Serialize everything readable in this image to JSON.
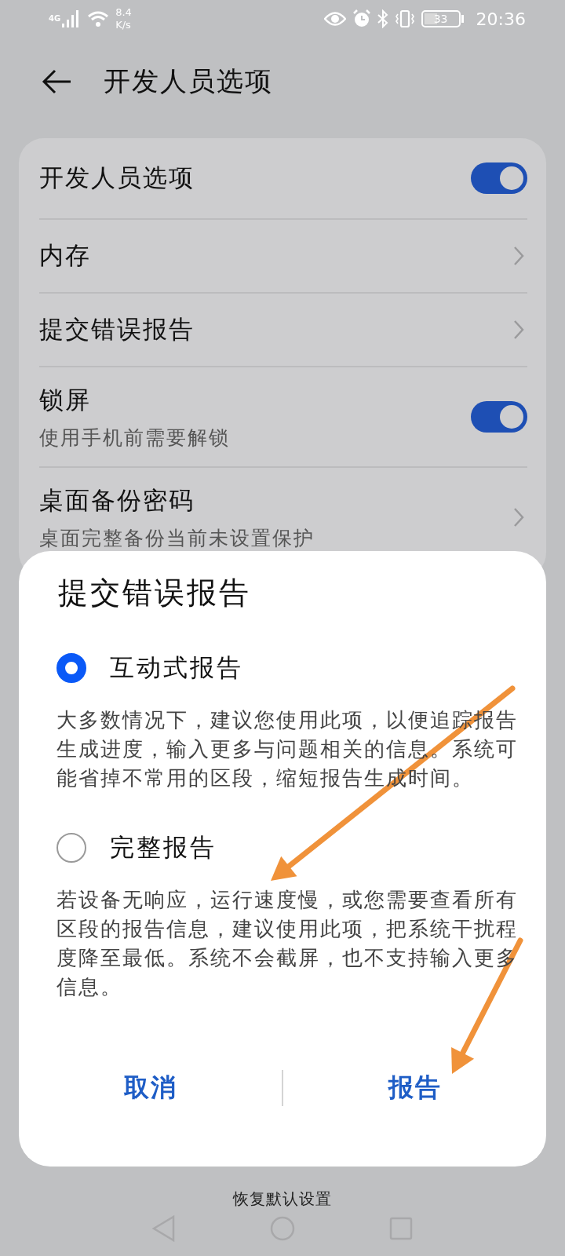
{
  "status_bar": {
    "network": "4G",
    "speed_value": "8.4",
    "speed_unit": "K/s",
    "battery": "33",
    "time": "20:36"
  },
  "header": {
    "title": "开发人员选项"
  },
  "settings": [
    {
      "kind": "toggle",
      "label": "开发人员选项",
      "on": true
    },
    {
      "kind": "link",
      "label": "内存"
    },
    {
      "kind": "link",
      "label": "提交错误报告"
    },
    {
      "kind": "toggle",
      "label": "锁屏",
      "subtitle": "使用手机前需要解锁",
      "on": true
    },
    {
      "kind": "link",
      "label": "桌面备份密码",
      "subtitle": "桌面完整备份当前未设置保护"
    }
  ],
  "footer_link": "恢复默认设置",
  "dialog": {
    "title": "提交错误报告",
    "options": [
      {
        "label": "互动式报告",
        "selected": true,
        "description": "大多数情况下，建议您使用此项，以便追踪报告生成进度，输入更多与问题相关的信息。系统可能省掉不常用的区段，缩短报告生成时间。"
      },
      {
        "label": "完整报告",
        "selected": false,
        "description": "若设备无响应，运行速度慢，或您需要查看所有区段的报告信息，建议使用此项，把系统干扰程度降至最低。系统不会截屏，也不支持输入更多信息。"
      }
    ],
    "buttons": [
      "取消",
      "报告"
    ]
  },
  "annotations": [
    {
      "kind": "arrow"
    },
    {
      "kind": "arrow"
    }
  ]
}
